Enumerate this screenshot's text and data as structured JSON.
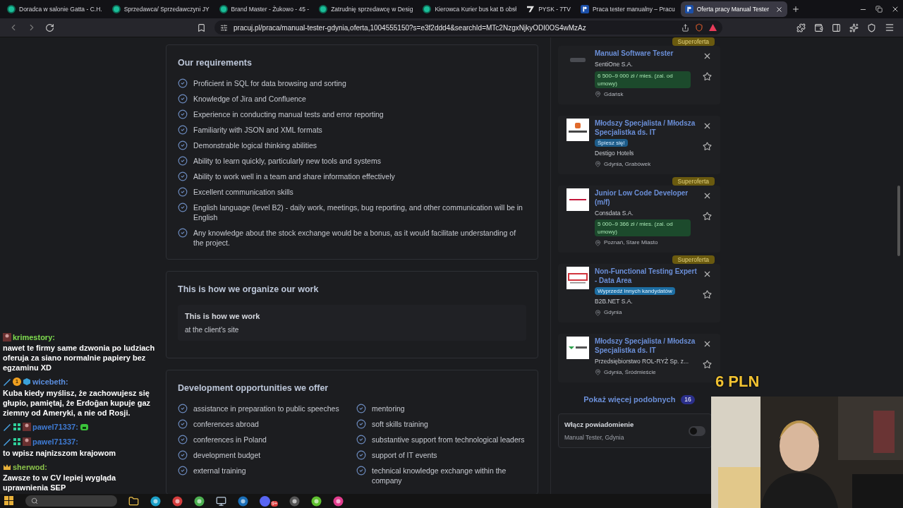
{
  "browser": {
    "tabs": [
      {
        "title": "Doradca w salonie Gatta - C.H.",
        "selected": false
      },
      {
        "title": "Sprzedawca/ Sprzedawczyni JY",
        "selected": false
      },
      {
        "title": "Brand Master - Żukowo - 45 -",
        "selected": false
      },
      {
        "title": "Zatrudnię sprzedawcę w Desig",
        "selected": false
      },
      {
        "title": "Kierowca Kurier bus kat B obsł",
        "selected": false
      },
      {
        "title": "PYSK - 7TV",
        "selected": false
      },
      {
        "title": "Praca tester manualny – Pracu",
        "selected": false
      },
      {
        "title": "Oferta pracy Manual Tester",
        "selected": true
      }
    ],
    "url": "pracuj.pl/praca/manual-tester-gdynia,oferta,1004555150?s=e3f2ddd4&searchId=MTc2NzgxNjkyODI0OS4wMzAz"
  },
  "requirements": {
    "heading": "Our requirements",
    "items": [
      "Proficient in SQL for data browsing and sorting",
      "Knowledge of Jira and Confluence",
      "Experience in conducting manual tests and error reporting",
      "Familiarity with JSON and XML formats",
      "Demonstrable logical thinking abilities",
      "Ability to learn quickly, particularly new tools and systems",
      "Ability to work well in a team and share information effectively",
      "Excellent communication skills",
      "English language (level B2) - daily work, meetings, bug reporting, and other communication will be in English",
      "Any knowledge about the stock exchange would be a bonus, as it would facilitate understanding of the project."
    ]
  },
  "organize": {
    "heading": "This is how we organize our work",
    "sub_heading": "This is how we work",
    "value": "at the client's site"
  },
  "development": {
    "heading": "Development opportunities we offer",
    "items": [
      "assistance in preparation to public speeches",
      "mentoring",
      "conferences abroad",
      "soft skills training",
      "conferences in Poland",
      "substantive support from technological leaders",
      "development budget",
      "support of IT events",
      "external training",
      "technical knowledge exchange within the company"
    ]
  },
  "similar_offers": [
    {
      "tag": "Superoferta",
      "title": "Manual Software Tester",
      "company": "SentiOne S.A.",
      "salary": "6 500–9 000 zł / mies. (zal. od umowy)",
      "location": "Gdańsk"
    },
    {
      "title": "Młodszy Specjalista / Młodsza Specjalistka ds. IT",
      "badge": {
        "text": "Śpiesz się!",
        "kind": "urgent"
      },
      "company": "Destigo Hotels",
      "location": "Gdynia, Grabówek"
    },
    {
      "tag": "Superoferta",
      "title": "Junior Low Code Developer (m/f)",
      "company": "Consdata S.A.",
      "salary": "5 000–9 366 zł / mies. (zal. od umowy)",
      "location": "Poznań, Stare Miasto"
    },
    {
      "tag": "Superoferta",
      "title": "Non-Functional Testing Expert - Data Area",
      "badge": {
        "text": "Wyprzedź innych kandydatów",
        "kind": "ahead"
      },
      "company": "B2B.NET S.A.",
      "location": "Gdynia"
    },
    {
      "title": "Młodszy Specjalista / Młodsza Specjalistka ds. IT",
      "company": "Przedsiębiorstwo ROL-RYŻ Sp. z...",
      "location": "Gdynia, Śródmieście"
    }
  ],
  "show_more": {
    "label": "Pokaż więcej podobnych",
    "count": "16"
  },
  "notify": {
    "title": "Włącz powiadomienie",
    "subtitle": "Manual Tester, Gdynia",
    "on": false
  },
  "chat": [
    {
      "user": "krimestory:",
      "color": "#7fdc4f",
      "kind": "text",
      "text": "nawet te firmy same dzwonia po ludziach oferuja za siano normalnie papiery bez egzaminu XD"
    },
    {
      "user": "wicebeth:",
      "color": "#5b8fe0",
      "number": "1",
      "kind": "text",
      "text": "Kuba kiedy myślisz, że zachowujesz się głupio, pamiętaj, że Erdoğan kupuje gaz ziemny od Ameryki, a nie od Rosji."
    },
    {
      "user": "pawel71337:",
      "color": "#3f7bd4",
      "kind": "emote"
    },
    {
      "user": "pawel71337:",
      "color": "#3f7bd4",
      "kind": "text",
      "text": "to wpisz najnizszom krajowom"
    },
    {
      "user": "sherwod:",
      "color": "#8bc34a",
      "kind": "text",
      "text": "Zawsze to w CV lepiej wygląda uprawnienia SEP"
    }
  ],
  "overlay_text": "6 PLN",
  "taskbar": {
    "notification_count": "9+"
  }
}
